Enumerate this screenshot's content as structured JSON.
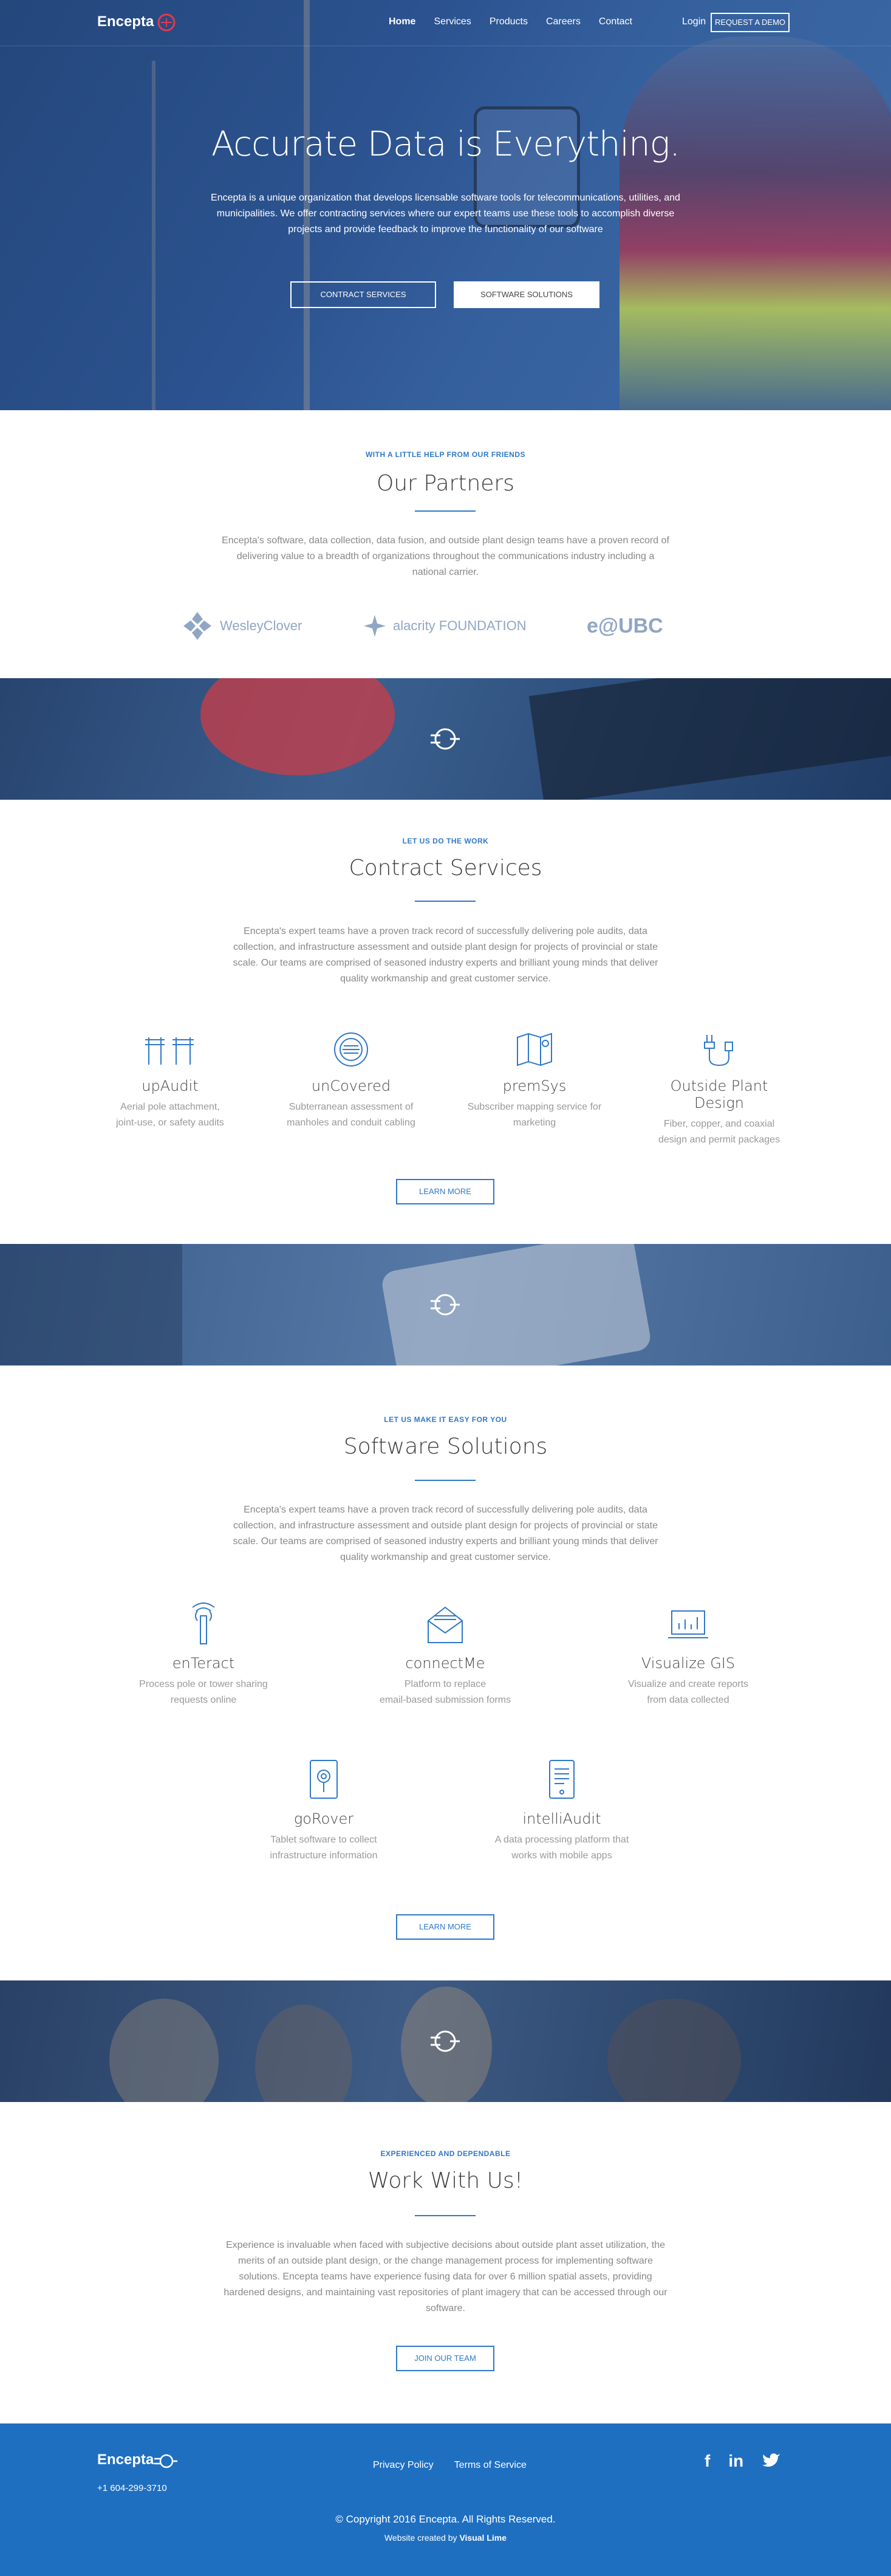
{
  "nav": {
    "brand": "Encepta",
    "links": [
      "Home",
      "Services",
      "Products",
      "Careers",
      "Contact"
    ],
    "login": "Login",
    "demo": "REQUEST A DEMO"
  },
  "hero": {
    "title": "Accurate Data is Everything.",
    "text": "Encepta is a unique organization that develops licensable software tools for telecommunications, utilities, and municipalities. We offer contracting services where our expert teams use these tools to accomplish diverse projects and provide feedback to improve the functionality of our software",
    "btn_contract": "CONTRACT SERVICES",
    "btn_software": "SOFTWARE SOLUTIONS"
  },
  "partners": {
    "eyebrow": "WITH A LITTLE HELP FROM OUR FRIENDS",
    "title": "Our Partners",
    "text": "Encepta's software, data collection, data fusion, and outside plant design teams have a proven record of delivering value to a breadth of organizations throughout the communications industry including a national carrier.",
    "logos": [
      "WesleyClover",
      "alacrity FOUNDATION",
      "e@UBC"
    ]
  },
  "contract": {
    "eyebrow": "LET US DO THE WORK",
    "title": "Contract Services",
    "text": "Encepta's expert teams have a proven track record of successfully delivering pole audits, data collection, and infrastructure assessment and outside plant design for projects of provincial or state scale. Our teams are comprised of seasoned industry experts and brilliant young minds that deliver quality workmanship and great customer service.",
    "items": [
      {
        "name": "upAudit",
        "desc1": "Aerial pole attachment,",
        "desc2": "joint-use, or safety audits"
      },
      {
        "name": "unCovered",
        "desc1": "Subterranean assessment of",
        "desc2": "manholes and conduit cabling"
      },
      {
        "name": "premSys",
        "desc1": "Subscriber mapping service for",
        "desc2": "marketing"
      },
      {
        "name": "Outside Plant Design",
        "desc1": "Fiber, copper, and coaxial",
        "desc2": "design and permit packages"
      }
    ],
    "learn": "LEARN MORE"
  },
  "software": {
    "eyebrow": "LET US MAKE IT EASY FOR YOU",
    "title": "Software Solutions",
    "text": "Encepta's expert teams have a proven track record of successfully delivering pole audits, data collection, and infrastructure assessment and outside plant design for projects of provincial or state scale. Our teams are comprised of seasoned industry experts and brilliant young minds that deliver quality workmanship and great customer service.",
    "items": [
      {
        "name": "enTeract",
        "desc1": "Process pole or tower sharing",
        "desc2": "requests online"
      },
      {
        "name": "connectMe",
        "desc1": "Platform to replace",
        "desc2": "email-based submission forms"
      },
      {
        "name": "Visualize GIS",
        "desc1": "Visualize and create reports",
        "desc2": "from data collected"
      },
      {
        "name": "goRover",
        "desc1": "Tablet software to collect",
        "desc2": "infrastructure information"
      },
      {
        "name": "intelliAudit",
        "desc1": "A data processing platform that",
        "desc2": "works with mobile apps"
      }
    ],
    "learn": "LEARN MORE"
  },
  "work": {
    "eyebrow": "EXPERIENCED AND DEPENDABLE",
    "title": "Work With Us!",
    "text": "Experience is invaluable when faced with subjective decisions about outside plant asset utilization, the merits of an outside plant design, or the change management process for implementing software solutions. Encepta teams have experience fusing data for over 6 million spatial assets, providing hardened designs, and maintaining vast repositories of plant imagery that can be accessed through our software.",
    "join": "JOIN OUR TEAM"
  },
  "footer": {
    "brand": "Encepta",
    "phone": "+1 604-299-3710",
    "privacy": "Privacy Policy",
    "terms": "Terms of Service",
    "copyright": "© Copyright 2016 Encepta. All Rights Reserved.",
    "credit_prefix": "Website created by ",
    "credit_name": "Visual Lime"
  },
  "colors": {
    "accent": "#2f78c8",
    "footer": "#1f6fc1",
    "hero_overlay": "#2c5390"
  }
}
